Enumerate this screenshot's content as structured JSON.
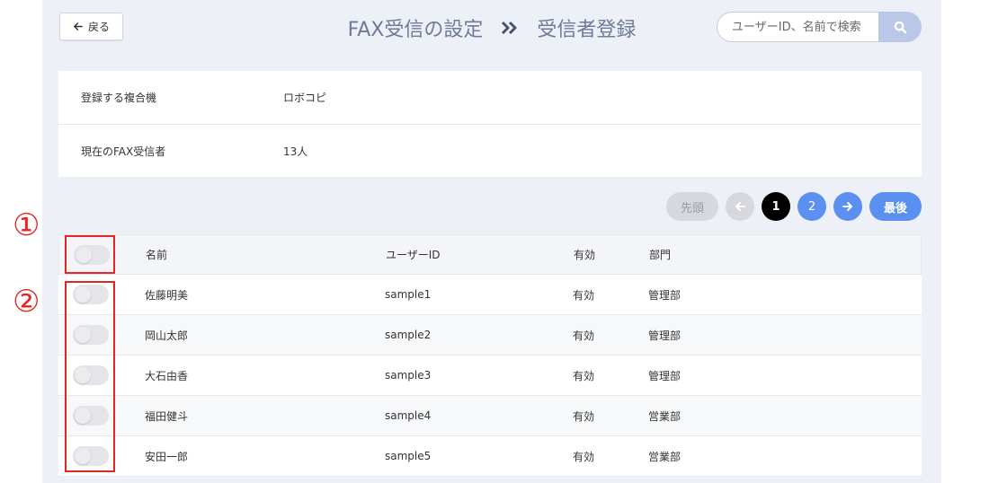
{
  "header": {
    "back_label": "戻る",
    "title_left": "FAX受信の設定",
    "title_right": "受信者登録",
    "search_placeholder": "ユーザーID、名前で検索"
  },
  "info": {
    "rows": [
      {
        "label": "登録する複合機",
        "value": "ロボコピ"
      },
      {
        "label": "現在のFAX受信者",
        "value": "13人"
      }
    ]
  },
  "pagination": {
    "first_label": "先頭",
    "pages": [
      "1",
      "2"
    ],
    "current_page": "1",
    "last_label": "最後"
  },
  "table": {
    "columns": [
      "名前",
      "ユーザーID",
      "有効",
      "部門"
    ],
    "rows": [
      {
        "name": "佐藤明美",
        "user_id": "sample1",
        "status": "有効",
        "dept": "管理部"
      },
      {
        "name": "岡山太郎",
        "user_id": "sample2",
        "status": "有効",
        "dept": "管理部"
      },
      {
        "name": "大石由香",
        "user_id": "sample3",
        "status": "有効",
        "dept": "管理部"
      },
      {
        "name": "福田健斗",
        "user_id": "sample4",
        "status": "有効",
        "dept": "営業部"
      },
      {
        "name": "安田一郎",
        "user_id": "sample5",
        "status": "有効",
        "dept": "営業部"
      }
    ]
  },
  "annotations": {
    "marker_1": "①",
    "marker_2": "②"
  },
  "colors": {
    "panel_bg": "#eef0f7",
    "accent_blue": "#5b8ff0",
    "annotation_red": "#e3261f",
    "title_text": "#707a99"
  },
  "icons": {
    "back": "arrow-left-icon",
    "separator": "double-chevron-right-icon",
    "search": "search-icon",
    "prev": "arrow-left-icon",
    "next": "arrow-right-icon"
  }
}
